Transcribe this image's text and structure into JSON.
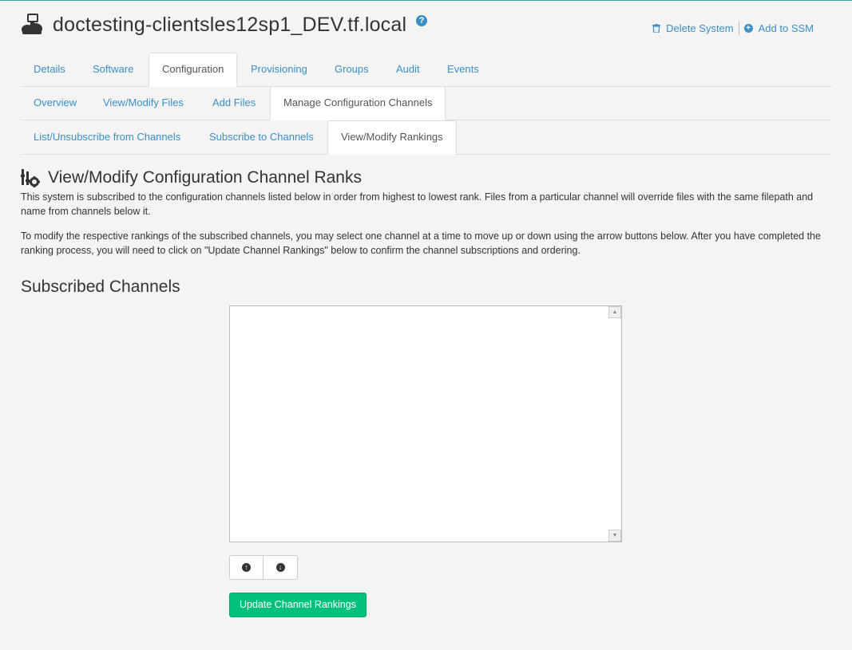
{
  "header": {
    "title": "doctesting-clientsles12sp1_DEV.tf.local",
    "help_glyph": "?",
    "delete_label": "Delete System",
    "add_ssm_label": "Add to SSM"
  },
  "tabs_level1": [
    "Details",
    "Software",
    "Configuration",
    "Provisioning",
    "Groups",
    "Audit",
    "Events"
  ],
  "tabs_level2": [
    "Overview",
    "View/Modify Files",
    "Add Files",
    "Manage Configuration Channels"
  ],
  "tabs_level3": [
    "List/Unsubscribe from Channels",
    "Subscribe to Channels",
    "View/Modify Rankings"
  ],
  "section": {
    "title": "View/Modify Configuration Channel Ranks",
    "para1": "This system is subscribed to the configuration channels listed below in order from highest to lowest rank. Files from a particular channel will override files with the same filepath and name from channels below it.",
    "para2": "To modify the respective rankings of the subscribed channels, you may select one channel at a time to move up or down using the arrow buttons below. After you have completed the ranking process, you will need to click on \"Update Channel Rankings\" below to confirm the channel subscriptions and ordering."
  },
  "subscribed": {
    "heading": "Subscribed Channels",
    "channels": [],
    "update_label": "Update Channel Rankings"
  },
  "icons": {
    "system": "system-icon",
    "help": "help-icon",
    "delete": "trash-icon",
    "add": "plus-circle-icon",
    "config": "config-channel-icon",
    "up": "arrow-up-circle-icon",
    "down": "arrow-down-circle-icon"
  },
  "colors": {
    "link": "#3a8fc7",
    "primary_button": "#00c17c",
    "top_border": "#35a2a0",
    "background": "#f4f4f4"
  }
}
